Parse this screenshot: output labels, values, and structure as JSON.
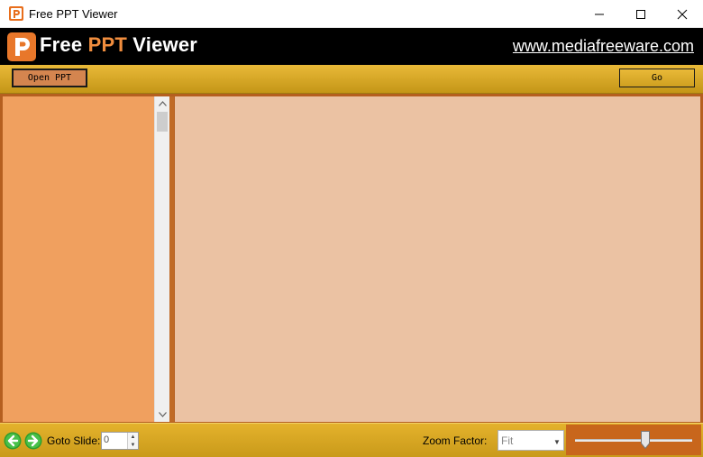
{
  "window": {
    "title": "Free PPT Viewer",
    "controls": [
      "minimize",
      "maximize",
      "close"
    ]
  },
  "banner": {
    "brand_part1": "Free ",
    "brand_accent": "PPT",
    "brand_part2": " Viewer",
    "website": "www.mediafreeware.com"
  },
  "toolbar": {
    "open_label": "Open PPT",
    "go_label": "Go"
  },
  "footer": {
    "goto_label": "Goto Slide:",
    "goto_value": "0",
    "zoom_label": "Zoom Factor:",
    "zoom_value": "Fit",
    "zoom_slider_level": 0.6
  },
  "icons": {
    "app": "ppt-logo-icon",
    "prev": "arrow-left-icon",
    "next": "arrow-right-icon"
  },
  "colors": {
    "accent": "#f08d3e",
    "toolbar": "#e0ad2e",
    "thumbnail_panel": "#f0a05f",
    "slide_area": "#ebc2a3",
    "zoom_panel": "#c8661c"
  }
}
